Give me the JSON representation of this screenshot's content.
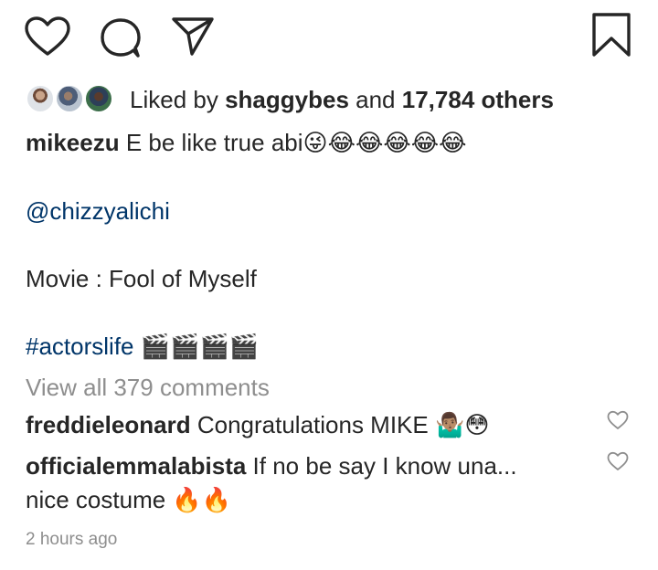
{
  "actions": {
    "like_icon": "heart-outline",
    "comment_icon": "speech-bubble-outline",
    "share_icon": "paper-plane-outline",
    "save_icon": "bookmark-outline"
  },
  "likes": {
    "prefix": "Liked by",
    "user": "shaggybes",
    "connector": "and",
    "count": "17,784 others"
  },
  "caption": {
    "username": "mikeezu",
    "text": "E be like true abi",
    "emoji": "😜😂😂😂😂😂",
    "mention": "@chizzyalichi",
    "movie_line": "Movie : Fool of Myself",
    "hashtag": "#actorslife",
    "hashtag_emoji": "🎬🎬🎬🎬"
  },
  "view_all_comments": "View all 379 comments",
  "comments": [
    {
      "username": "freddieleonard",
      "text": "Congratulations MIKE",
      "emoji": "🤷🏽‍♂️😳"
    },
    {
      "username": "officialemmalabista",
      "text": "If no be say I know una...",
      "text2": "nice costume",
      "emoji": "🔥🔥"
    }
  ],
  "timestamp": "2 hours ago",
  "colors": {
    "text": "#262626",
    "link": "#003569",
    "muted": "#8e8e8e"
  }
}
